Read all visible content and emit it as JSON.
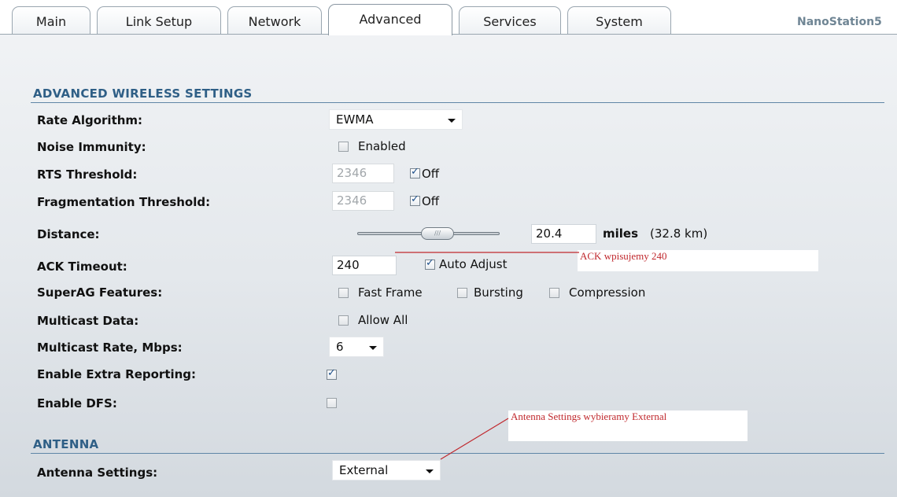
{
  "tabs": [
    {
      "label": "Main",
      "active": false
    },
    {
      "label": "Link Setup",
      "active": false
    },
    {
      "label": "Network",
      "active": false
    },
    {
      "label": "Advanced",
      "active": true
    },
    {
      "label": "Services",
      "active": false
    },
    {
      "label": "System",
      "active": false
    }
  ],
  "device_name": "NanoStation5",
  "advanced_wireless": {
    "title": "ADVANCED WIRELESS SETTINGS",
    "rate_algorithm": {
      "label": "Rate Algorithm:",
      "value": "EWMA"
    },
    "noise_immunity": {
      "label": "Noise Immunity:",
      "checkbox_label": "Enabled",
      "checked": false
    },
    "rts_threshold": {
      "label": "RTS Threshold:",
      "value": "2346",
      "off_label": "Off",
      "off_checked": true
    },
    "fragmentation_threshold": {
      "label": "Fragmentation Threshold:",
      "value": "2346",
      "off_label": "Off",
      "off_checked": true
    },
    "distance": {
      "label": "Distance:",
      "value": "20.4",
      "unit": "miles",
      "km_text": "(32.8 km)"
    },
    "ack_timeout": {
      "label": "ACK Timeout:",
      "value": "240",
      "auto_adjust_label": "Auto Adjust",
      "auto_adjust_checked": true
    },
    "superag": {
      "label": "SuperAG Features:",
      "fast_frame": "Fast Frame",
      "bursting": "Bursting",
      "compression": "Compression"
    },
    "multicast_data": {
      "label": "Multicast Data:",
      "checkbox_label": "Allow All",
      "checked": false
    },
    "multicast_rate": {
      "label": "Multicast Rate, Mbps:",
      "value": "6"
    },
    "extra_reporting": {
      "label": "Enable Extra Reporting:",
      "checked": true
    },
    "dfs": {
      "label": "Enable DFS:",
      "checked": false
    }
  },
  "antenna": {
    "title": "ANTENNA",
    "settings": {
      "label": "Antenna Settings:",
      "value": "External"
    }
  },
  "annotations": {
    "ack_note": "ACK wpisujemy 240",
    "antenna_note": "Antenna Settings wybieramy External",
    "color": "#c0282d"
  },
  "colors": {
    "section_title": "#2f5f86",
    "brand": "#6f8594",
    "checkbox_tick": "#1c4f8a"
  }
}
